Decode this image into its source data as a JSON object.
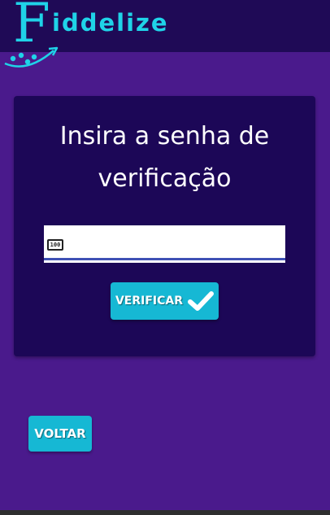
{
  "header": {
    "logo_initial": "F",
    "logo_rest": "iddelize"
  },
  "colors": {
    "page_background": "#4a1a8c",
    "header_background": "#1f0a56",
    "card_background": "#1c0757",
    "accent_cyan": "#1fd3e8",
    "button_background": "#16b8d4",
    "input_underline": "#3f51b5"
  },
  "card": {
    "title_line1": "Insira a senha de",
    "title_line2": "verificação",
    "input": {
      "icon": "numeric-keypad-icon",
      "icon_text": "100",
      "value": "",
      "placeholder": ""
    },
    "verify_button": {
      "label": "VERIFICAR",
      "icon": "check-icon"
    }
  },
  "back_button": {
    "label": "VOLTAR"
  }
}
